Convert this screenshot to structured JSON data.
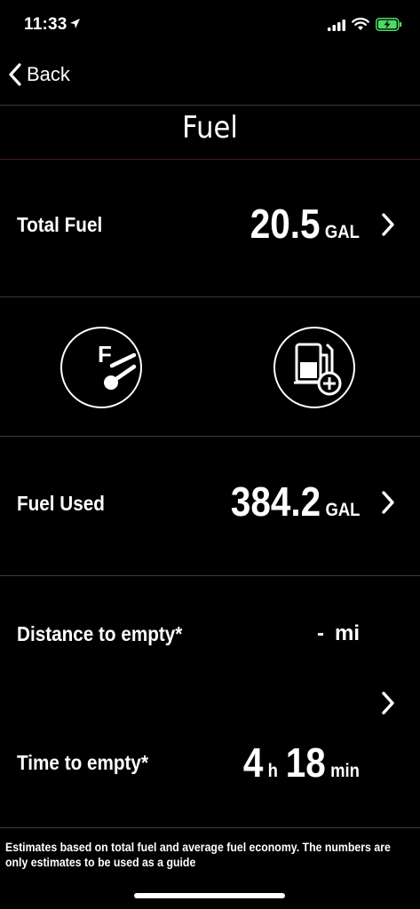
{
  "status": {
    "time": "11:33"
  },
  "nav": {
    "back_label": "Back",
    "title": "Fuel"
  },
  "total_fuel": {
    "label": "Total Fuel",
    "value": "20.5",
    "unit": "GAL"
  },
  "actions": {
    "gauge_icon_letter": "F",
    "left": "fuel-gauge-icon",
    "right": "fuel-pump-add-icon"
  },
  "fuel_used": {
    "label": "Fuel Used",
    "value": "384.2",
    "unit": "GAL"
  },
  "distance": {
    "label": "Distance to empty*",
    "value": "-",
    "unit": "mi"
  },
  "time_to_empty": {
    "label": "Time to empty*",
    "hours": "4",
    "hours_unit": "h",
    "minutes": "18",
    "minutes_unit": "min"
  },
  "footnote": "Estimates based on total fuel and average fuel economy. The numbers are only estimates to be used as a guide",
  "colors": {
    "background": "#000000",
    "text": "#ffffff",
    "divider": "#3a3a3a",
    "title_divider": "#4a1e1e",
    "battery_fill": "#4cd964"
  }
}
